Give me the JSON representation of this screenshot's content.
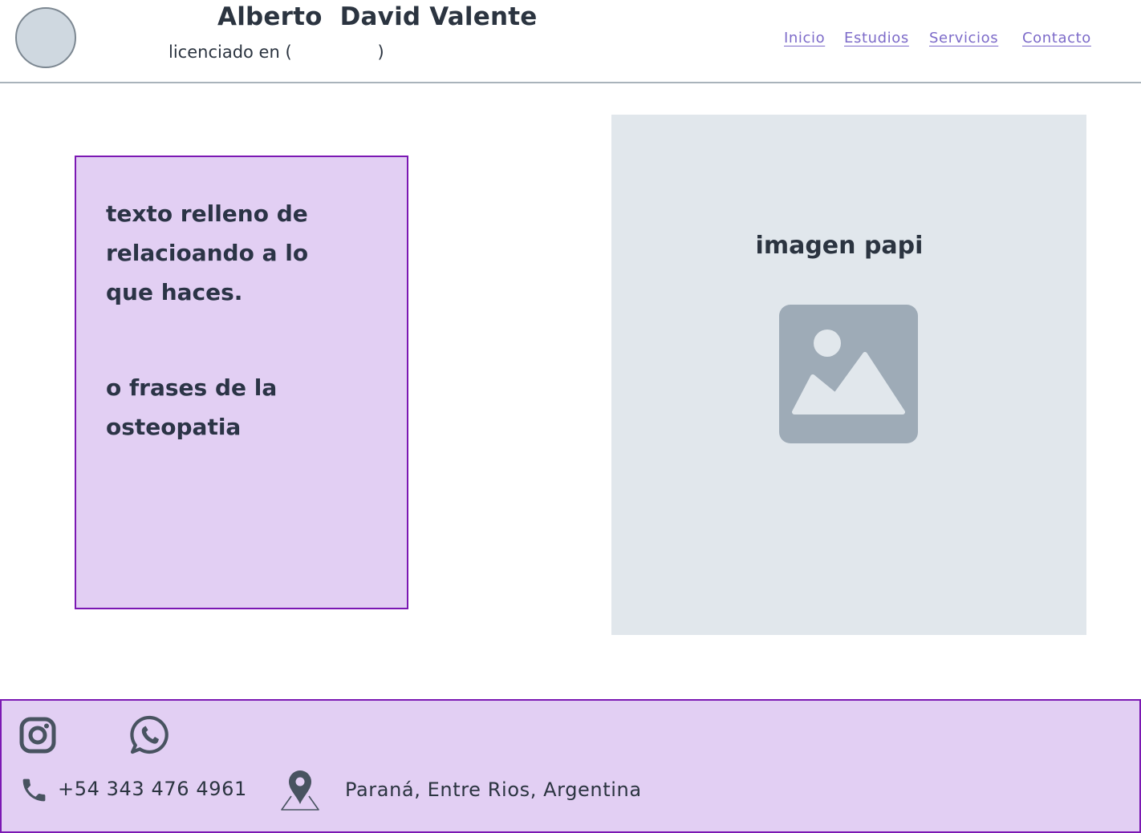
{
  "header": {
    "name": "Alberto  David Valente",
    "subtitle": "licenciado en (                )",
    "nav": [
      "Inicio",
      "Estudios",
      "Servicios",
      "Contacto"
    ]
  },
  "main": {
    "card_paragraphs": [
      "texto relleno de relacioando a lo que haces.",
      "o frases de la osteopatia"
    ],
    "image_title": "imagen papi"
  },
  "footer": {
    "phone": "+54 343 476 4961",
    "location": "Paraná, Entre Rios, Argentina"
  },
  "colors": {
    "accent_purple": "#7b18b3",
    "card_background": "#e2cff3",
    "nav_link": "#7d6bc9",
    "text_dark": "#2b3440",
    "panel_gray": "#e1e7ec",
    "icon_gray": "#9eabb7"
  },
  "icons": [
    "instagram-icon",
    "whatsapp-icon",
    "phone-icon",
    "map-pin-icon",
    "image-placeholder-icon"
  ]
}
